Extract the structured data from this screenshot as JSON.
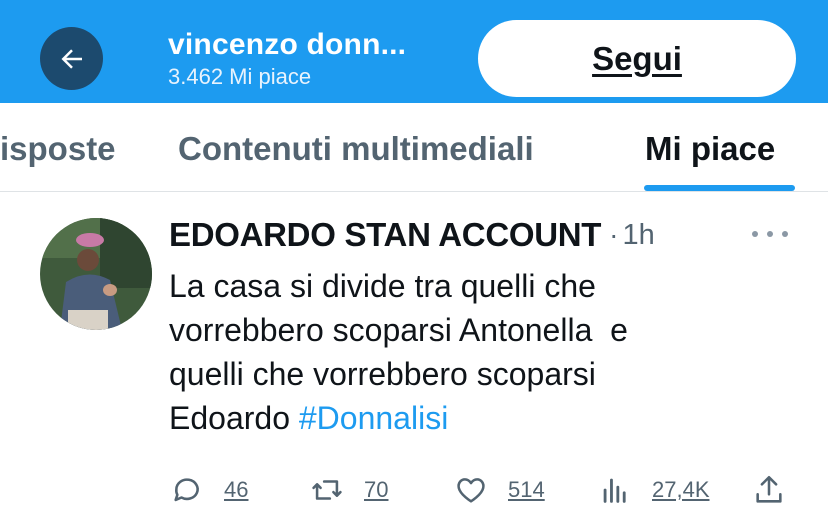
{
  "header": {
    "profile_name": "vincenzo donn...",
    "likes_count": "3.462 Mi piace",
    "follow_label": "Segui",
    "back_icon": "arrow-left-icon"
  },
  "tabs": [
    {
      "label": "isposte",
      "active": false
    },
    {
      "label": "Contenuti multimediali",
      "active": false
    },
    {
      "label": "Mi piace",
      "active": true
    }
  ],
  "tweet": {
    "author": "EDOARDO STAN ACCOUNT",
    "separator": "·",
    "time": "1h",
    "text_lines": [
      "La casa si divide tra quelli che",
      "vorrebbero scoparsi Antonella  e",
      "quelli che vorrebbero scoparsi",
      "Edoardo "
    ],
    "hashtag": "#Donnalisi",
    "actions": {
      "replies": "46",
      "retweets": "70",
      "likes": "514",
      "views": "27,4K"
    }
  },
  "colors": {
    "header_bg": "#1d9bf0",
    "back_button_bg": "#1c4a6e",
    "accent": "#1d9bf0",
    "muted": "#536471"
  }
}
